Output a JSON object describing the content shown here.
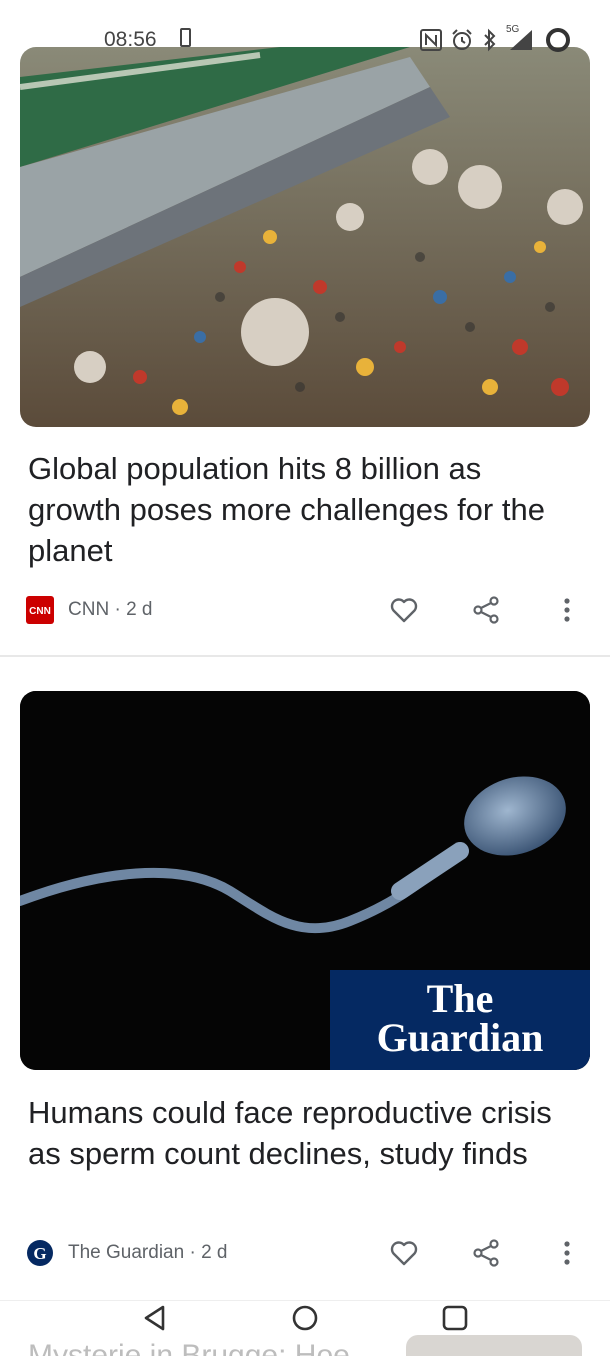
{
  "status": {
    "time": "08:56",
    "network_label": "5G",
    "icons": [
      "phone-outline-icon",
      "nfc-icon",
      "alarm-icon",
      "bluetooth-icon",
      "signal-icon",
      "battery-ring-icon"
    ]
  },
  "articles": [
    {
      "title": "Global population hits 8 billion as growth poses more challenges for the planet",
      "source": "CNN",
      "logo_text": "CNN",
      "age": "2 d",
      "image": "crowded-market-photo",
      "colors": {
        "logo_bg": "#cc0000"
      }
    },
    {
      "title": "Humans could face reproductive crisis as sperm count declines, study finds",
      "source": "The Guardian",
      "logo_text": "G",
      "age": "2 d",
      "image": "sperm-cell-photo",
      "overlay_line1": "The",
      "overlay_line2": "Guardian",
      "colors": {
        "logo_bg": "#052962",
        "overlay_bg": "#052962"
      }
    }
  ],
  "next_article": {
    "title_partial": "Mysterie in Brugge: Hoe"
  },
  "separator": " · ",
  "nav": {
    "icons": [
      "back-triangle-icon",
      "home-circle-icon",
      "recents-square-icon"
    ]
  }
}
